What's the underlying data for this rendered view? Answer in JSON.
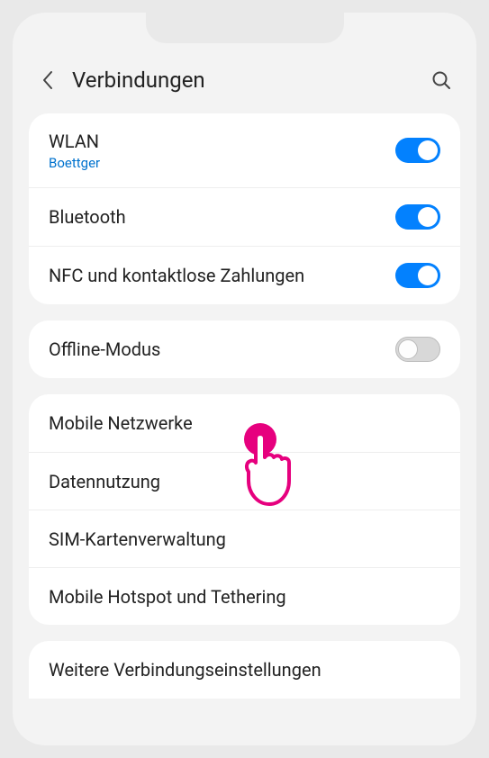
{
  "header": {
    "title": "Verbindungen"
  },
  "group1": {
    "wlan": {
      "title": "WLAN",
      "sub": "Boettger",
      "on": true
    },
    "bluetooth": {
      "title": "Bluetooth",
      "on": true
    },
    "nfc": {
      "title": "NFC und kontaktlose Zahlungen",
      "on": true
    }
  },
  "group2": {
    "offline": {
      "title": "Offline-Modus",
      "on": false
    }
  },
  "group3": {
    "mobile_net": {
      "title": "Mobile Netzwerke"
    },
    "data_usage": {
      "title": "Datennutzung"
    },
    "sim": {
      "title": "SIM-Kartenverwaltung"
    },
    "hotspot": {
      "title": "Mobile Hotspot und Tethering"
    }
  },
  "group4": {
    "more": {
      "title": "Weitere Verbindungseinstellungen"
    }
  }
}
